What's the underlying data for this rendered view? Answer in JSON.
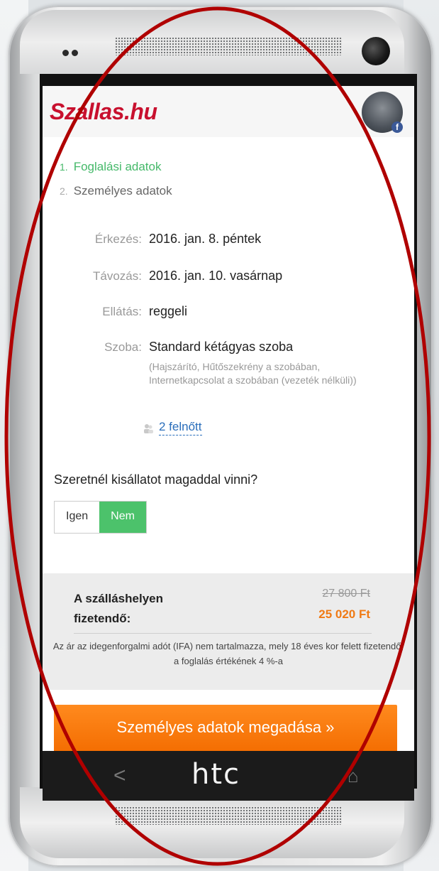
{
  "app": {
    "logo": "Szallas.hu",
    "facebook_badge": "f",
    "brand": "htc"
  },
  "steps": [
    {
      "num": "1.",
      "label": "Foglalási adatok",
      "state": "active"
    },
    {
      "num": "2.",
      "label": "Személyes adatok",
      "state": "inactive"
    }
  ],
  "booking": {
    "arrival_label": "Érkezés:",
    "arrival_value": "2016. jan. 8. péntek",
    "departure_label": "Távozás:",
    "departure_value": "2016. jan. 10. vasárnap",
    "board_label": "Ellátás:",
    "board_value": "reggeli",
    "room_label": "Szoba:",
    "room_value": "Standard kétágyas szoba",
    "room_detail": "(Hajszárító, Hűtőszekrény a szobában, Internetkapcsolat a szobában (vezeték nélküli))",
    "guests": "2 felnőtt"
  },
  "pet": {
    "question": "Szeretnél kisállatot magaddal vinni?",
    "yes": "Igen",
    "no": "Nem",
    "selected": "no"
  },
  "price": {
    "label_line1": "A szálláshelyen",
    "label_line2": "fizetendő:",
    "old": "27 800 Ft",
    "new": "25 020 Ft",
    "tax_note": "Az ár az idegenforgalmi adót (IFA) nem tartalmazza, mely 18 éves kor felett fizetendő, a foglalás értékének 4 %-a"
  },
  "cta": {
    "label": "Személyes adatok megadása »"
  },
  "navbar": {
    "back": "<",
    "home": "⌂"
  },
  "colors": {
    "brand_red": "#c8102e",
    "active_green": "#45b96a",
    "toggle_green": "#4cc26b",
    "price_orange": "#f07a14",
    "cta_orange": "#f36c00",
    "annotation_red": "#b00000"
  }
}
